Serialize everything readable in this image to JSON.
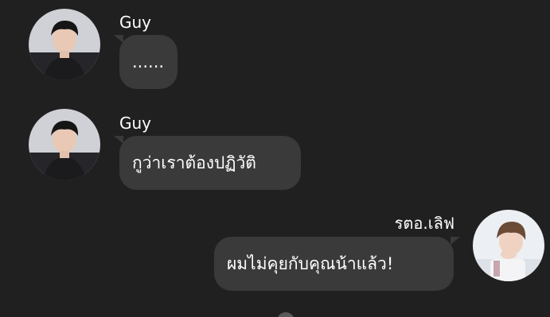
{
  "messages": [
    {
      "sender": "Guy",
      "text": "......",
      "avatar": "avatar-guy",
      "side": "left"
    },
    {
      "sender": "Guy",
      "text": "กูว่าเราต้องปฏิวัติ",
      "avatar": "avatar-guy",
      "side": "left"
    },
    {
      "sender": "รตอ.เลิฟ",
      "text": "ผมไม่คุยกับคุณน้าแล้ว!",
      "avatar": "avatar-love",
      "side": "right"
    }
  ],
  "colors": {
    "background": "#202020",
    "bubble": "#3a3a3a",
    "text": "#ffffff"
  }
}
